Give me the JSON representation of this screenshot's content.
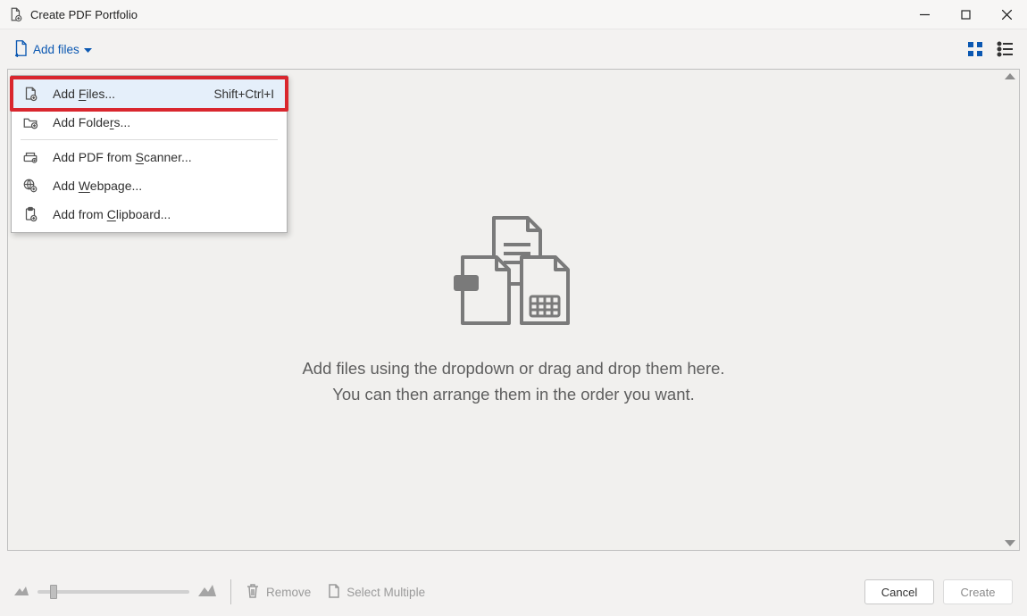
{
  "window": {
    "title": "Create PDF Portfolio"
  },
  "toolbar": {
    "add_files_label": "Add files"
  },
  "menu": {
    "add_files": {
      "label": "Add Files...",
      "shortcut": "Shift+Ctrl+I",
      "underline": "F"
    },
    "add_folders": {
      "label": "Add Folders...",
      "underline": "r"
    },
    "add_scanner": {
      "label": "Add PDF from Scanner...",
      "underline": "S"
    },
    "add_webpage": {
      "label": "Add Webpage...",
      "underline": "W"
    },
    "add_clipboard": {
      "label": "Add from Clipboard...",
      "underline": "C"
    }
  },
  "drop": {
    "line1": "Add files using the dropdown or drag and drop them here.",
    "line2": "You can then arrange them in the order you want."
  },
  "footer": {
    "remove": "Remove",
    "select_multiple": "Select Multiple",
    "cancel": "Cancel",
    "create": "Create"
  }
}
